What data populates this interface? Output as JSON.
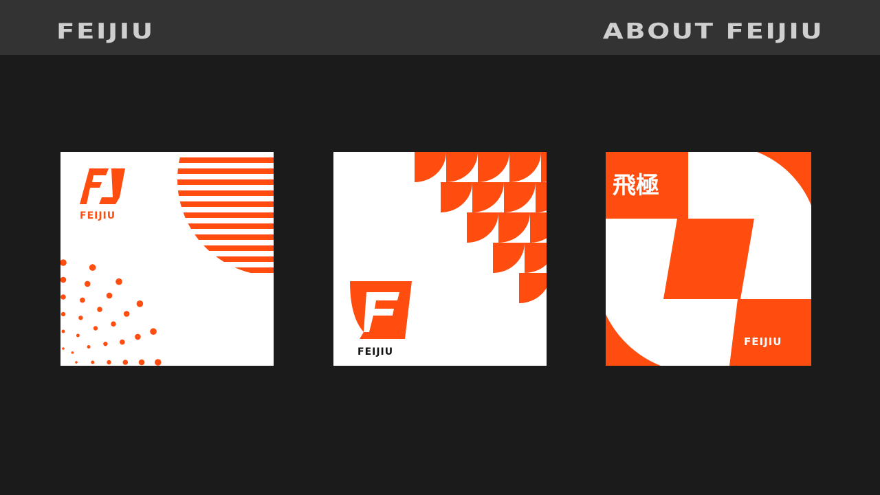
{
  "header": {
    "brand": "FEIJIU",
    "about": "ABOUT FEIJIU"
  },
  "colors": {
    "accent": "#ff4c0f",
    "background": "#1b1b1b",
    "topbar": "#333333",
    "card_white": "#ffffff",
    "header_text": "#cfcfcf"
  },
  "cards": [
    {
      "logo_text": "FEIJIU",
      "icon": "fj-monogram-icon"
    },
    {
      "logo_text": "FEIJIU",
      "icon": "f-shield-icon"
    },
    {
      "chinese_text": "飛極",
      "logo_text": "FEIJIU"
    }
  ]
}
